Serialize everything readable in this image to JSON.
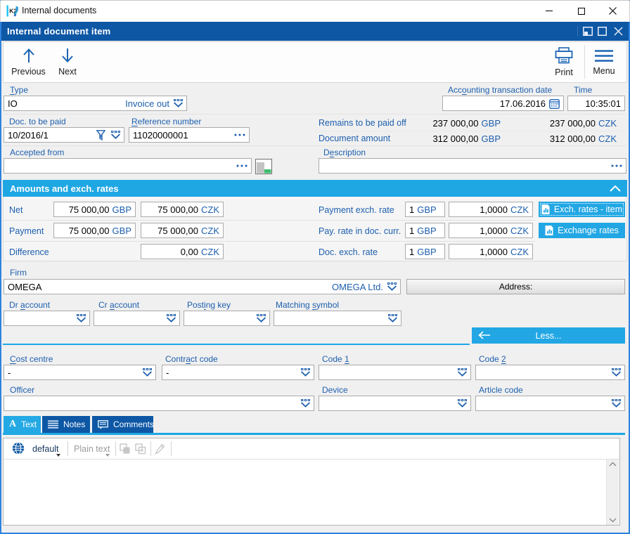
{
  "window": {
    "title": "Internal documents",
    "logo_text": "K2"
  },
  "dialog": {
    "title": "Internal document item"
  },
  "toolbar": {
    "previous": "Previous",
    "next": "Next",
    "print": "Print",
    "menu": "Menu"
  },
  "colors": {
    "dark_blue": "#0D57A5",
    "cyan": "#1FA7E4",
    "label_blue": "#1D5FAE",
    "frame_blue": "#2E82DE",
    "green": "#3DBE6E"
  },
  "form": {
    "type": {
      "label_key": "T",
      "label_rest": "ype",
      "code": "IO",
      "display": "Invoice out"
    },
    "acc_date": {
      "label_pre": "Acc",
      "label_key": "o",
      "label_rest": "unting transaction date",
      "value": "17.06.2016"
    },
    "time": {
      "label": "Time",
      "value": "10:35:01"
    },
    "doc_paid": {
      "label": "Doc. to be paid",
      "value": "10/2016/1"
    },
    "reference": {
      "label_key": "R",
      "label_rest": "eference number",
      "value": "11020000001"
    },
    "remains": {
      "label": "Remains to be paid off",
      "v1": "237 000,00",
      "c1": "GBP",
      "v2": "237 000,00",
      "c2": "CZK"
    },
    "doc_amount": {
      "label": "Document amount",
      "v1": "312 000,00",
      "c1": "GBP",
      "v2": "312 000,00",
      "c2": "CZK"
    },
    "accepted": {
      "label": "Accepted from",
      "value": ""
    },
    "description": {
      "label_pre": "D",
      "label_key": "e",
      "label_rest": "scription",
      "value": ""
    }
  },
  "amounts": {
    "header": "Amounts and exch. rates",
    "rows": [
      {
        "label": "Net",
        "gbp": "75 000,00",
        "gbp_cur": "GBP",
        "czk": "75 000,00",
        "czk_cur": "CZK"
      },
      {
        "label": "Payment",
        "gbp": "75 000,00",
        "gbp_cur": "GBP",
        "czk": "75 000,00",
        "czk_cur": "CZK"
      },
      {
        "label": "Difference",
        "czk": "0,00",
        "czk_cur": "CZK"
      }
    ],
    "rates": [
      {
        "label": "Payment exch. rate",
        "unit": "1",
        "unit_cur": "GBP",
        "value": "1,0000",
        "value_cur": "CZK"
      },
      {
        "label": "Pay. rate in doc. curr.",
        "unit": "1",
        "unit_cur": "GBP",
        "value": "1,0000",
        "value_cur": "CZK"
      },
      {
        "label": "Doc. exch. rate",
        "unit": "1",
        "unit_cur": "GBP",
        "value": "1,0000",
        "value_cur": "CZK"
      }
    ],
    "buttons": [
      {
        "label": "Exch. rates - item"
      },
      {
        "label": "Exchange rates"
      }
    ]
  },
  "firm": {
    "label": "Firm",
    "value": "OMEGA",
    "display": "OMEGA Ltd.",
    "address_button": "Address:"
  },
  "accounts": {
    "dr": {
      "label_pre": "Dr ",
      "label_key": "a",
      "label_rest": "ccount",
      "value": ""
    },
    "cr": {
      "label_pre": "Cr ",
      "label_key": "a",
      "label_rest": "ccount",
      "value": ""
    },
    "posting": {
      "label_pre": "Post",
      "label_key": "i",
      "label_rest": "ng key",
      "value": ""
    },
    "matching": {
      "label_pre": "Matching ",
      "label_key": "s",
      "label_rest": "ymbol",
      "value": ""
    }
  },
  "less_button": "Less...",
  "codes": {
    "cost": {
      "label_pre": "",
      "label_key": "C",
      "label_rest": "ost centre",
      "value": "-"
    },
    "contract": {
      "label_pre": "Contr",
      "label_key": "a",
      "label_rest": "ct code",
      "value": "-"
    },
    "code1": {
      "label_pre": "Code ",
      "label_key": "1",
      "label_rest": "",
      "value": ""
    },
    "code2": {
      "label_pre": "Code ",
      "label_key": "2",
      "label_rest": "",
      "value": ""
    },
    "officer": {
      "label": "Officer",
      "value": ""
    },
    "device": {
      "label": "Device",
      "value": ""
    },
    "article": {
      "label": "Article code",
      "value": ""
    }
  },
  "tabs": [
    {
      "label": "Text",
      "icon_letter": "A"
    },
    {
      "label": "Notes"
    },
    {
      "label": "Comments"
    }
  ],
  "editor": {
    "language": "default",
    "format": "Plain text",
    "content": ""
  }
}
